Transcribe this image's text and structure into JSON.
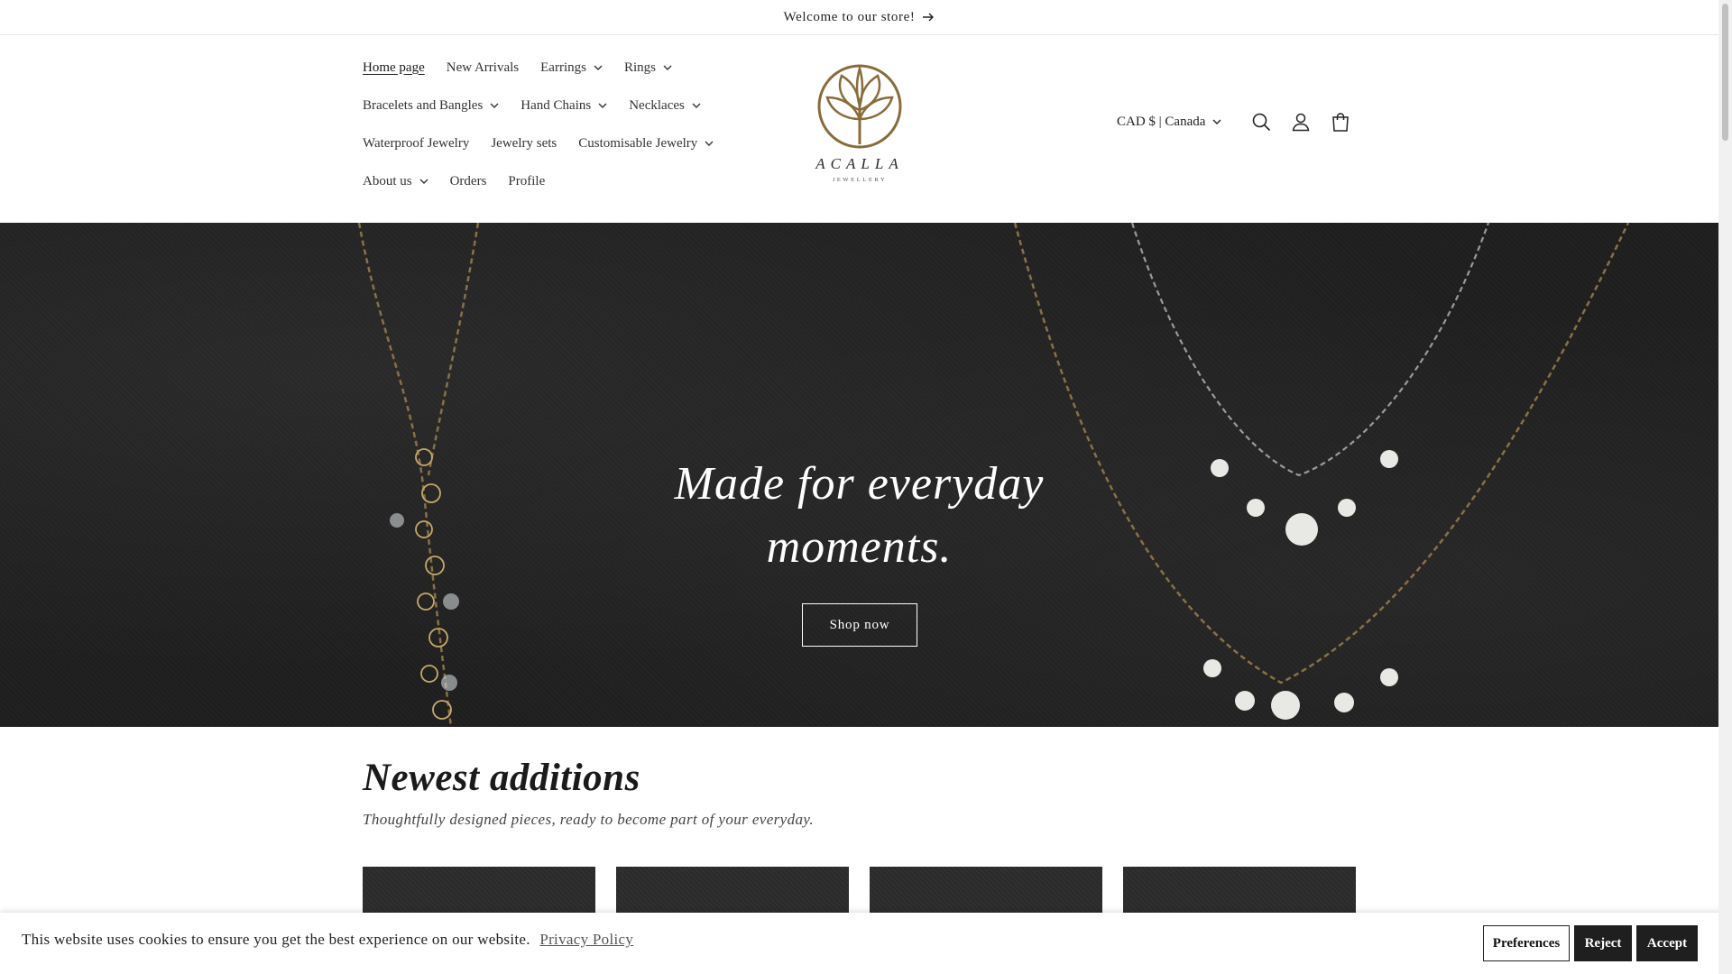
{
  "announcement": {
    "text": "Welcome to our store!",
    "icon": "arrow-right-icon"
  },
  "nav": {
    "rows": [
      [
        {
          "label": "Home page",
          "active": true,
          "dropdown": false
        },
        {
          "label": "New Arrivals",
          "dropdown": false
        },
        {
          "label": "Earrings",
          "dropdown": true
        },
        {
          "label": "Rings",
          "dropdown": true
        }
      ],
      [
        {
          "label": "Bracelets and Bangles",
          "dropdown": true
        },
        {
          "label": "Hand Chains",
          "dropdown": true
        },
        {
          "label": "Necklaces",
          "dropdown": true
        }
      ],
      [
        {
          "label": "Waterproof Jewelry",
          "dropdown": false
        },
        {
          "label": "Jewelry sets",
          "dropdown": false
        },
        {
          "label": "Customisable Jewelry",
          "dropdown": true
        }
      ],
      [
        {
          "label": "About us",
          "dropdown": true
        },
        {
          "label": "Orders",
          "dropdown": false
        },
        {
          "label": "Profile",
          "dropdown": false
        }
      ]
    ]
  },
  "logo": {
    "name": "ACALLA",
    "subtitle": "JEWELLERY"
  },
  "header_tools": {
    "currency": "CAD $ | Canada",
    "icons": [
      "search-icon",
      "account-icon",
      "cart-icon"
    ]
  },
  "hero": {
    "title_line1": "Made for everyday",
    "title_line2": "moments.",
    "button": "Shop now"
  },
  "newest": {
    "title": "Newest additions",
    "subtitle": "Thoughtfully designed pieces, ready to become part of your everyday."
  },
  "cookie": {
    "text": "This website uses cookies to ensure you get the best experience on our website.",
    "link": "Privacy Policy",
    "buttons": {
      "preferences": "Preferences",
      "reject": "Reject",
      "accept": "Accept"
    }
  },
  "colors": {
    "hero_bg": "#1f1f1f",
    "gold": "#8a6b3a",
    "button_dark": "#1f1f1f"
  }
}
